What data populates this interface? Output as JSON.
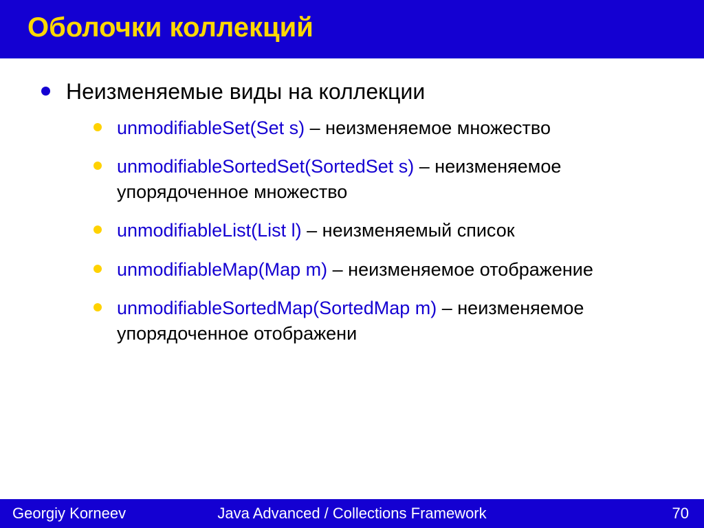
{
  "title": "Оболочки коллекций",
  "main_heading": "Неизменяемые виды на коллекции",
  "items": [
    {
      "code": "unmodifiableSet(Set s)",
      "sep": " – ",
      "desc": "неизменяемое множество"
    },
    {
      "code": "unmodifiableSortedSet(SortedSet s)",
      "sep": " – ",
      "desc": "неизменяемое упорядоченное множество"
    },
    {
      "code": "unmodifiableList(List l)",
      "sep": " – ",
      "desc": "неизменяемый список"
    },
    {
      "code": "unmodifiableMap(Map m)",
      "sep": " – ",
      "desc": "неизменяемое отображение"
    },
    {
      "code": "unmodifiableSortedMap(SortedMap m)",
      "sep": " – ",
      "desc": "неизменяемое упорядоченное отображени"
    }
  ],
  "footer": {
    "author": "Georgiy Korneev",
    "course": "Java Advanced / Collections Framework",
    "page": "70"
  }
}
